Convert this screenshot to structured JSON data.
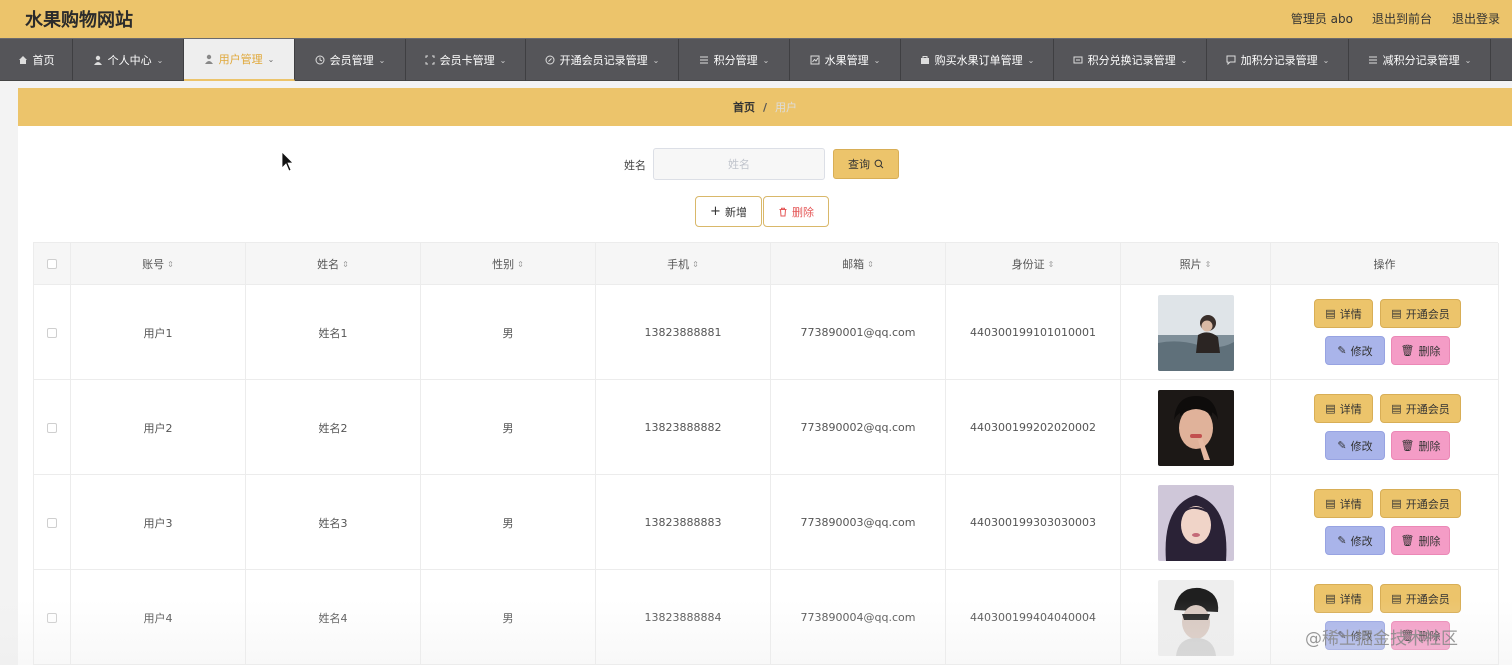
{
  "app": {
    "title": "水果购物网站"
  },
  "header": {
    "user_label": "管理员 abo",
    "to_front_label": "退出到前台",
    "logout_label": "退出登录"
  },
  "nav": {
    "items": [
      {
        "label": "首页",
        "icon": "home-icon"
      },
      {
        "label": "个人中心",
        "icon": "user-icon"
      },
      {
        "label": "用户管理",
        "icon": "user-icon"
      },
      {
        "label": "会员管理",
        "icon": "clock-icon"
      },
      {
        "label": "会员卡管理",
        "icon": "card-icon"
      },
      {
        "label": "开通会员记录管理",
        "icon": "compass-icon"
      },
      {
        "label": "积分管理",
        "icon": "list-icon"
      },
      {
        "label": "水果管理",
        "icon": "chart-icon"
      },
      {
        "label": "购买水果订单管理",
        "icon": "shop-icon"
      },
      {
        "label": "积分兑换记录管理",
        "icon": "ticket-icon"
      },
      {
        "label": "加积分记录管理",
        "icon": "message-icon"
      },
      {
        "label": "减积分记录管理",
        "icon": "list-icon"
      }
    ],
    "active_index": 2
  },
  "breadcrumb": {
    "home": "首页",
    "separator": "/",
    "current": "用户"
  },
  "search": {
    "label": "姓名",
    "placeholder": "姓名",
    "value": "",
    "query_label": "查询"
  },
  "actions": {
    "add_label": "新增",
    "delete_label": "删除"
  },
  "table": {
    "columns": [
      "账号",
      "姓名",
      "性别",
      "手机",
      "邮箱",
      "身份证",
      "照片",
      "操作"
    ],
    "rows": [
      {
        "account": "用户1",
        "name": "姓名1",
        "gender": "男",
        "phone": "13823888881",
        "email": "773890001@qq.com",
        "id_card": "440300199101010001"
      },
      {
        "account": "用户2",
        "name": "姓名2",
        "gender": "男",
        "phone": "13823888882",
        "email": "773890002@qq.com",
        "id_card": "440300199202020002"
      },
      {
        "account": "用户3",
        "name": "姓名3",
        "gender": "男",
        "phone": "13823888883",
        "email": "773890003@qq.com",
        "id_card": "440300199303030003"
      },
      {
        "account": "用户4",
        "name": "姓名4",
        "gender": "男",
        "phone": "13823888884",
        "email": "773890004@qq.com",
        "id_card": "440300199404040004"
      }
    ],
    "row_actions": {
      "detail_label": "详情",
      "vip_label": "开通会员",
      "edit_label": "修改",
      "delete_label": "删除"
    }
  },
  "watermark": "@稀土掘金技术社区",
  "colors": {
    "primary": "#ecc46b",
    "nav_bg": "#555559",
    "edit": "#a9b4ea",
    "danger": "#f49cc6"
  }
}
